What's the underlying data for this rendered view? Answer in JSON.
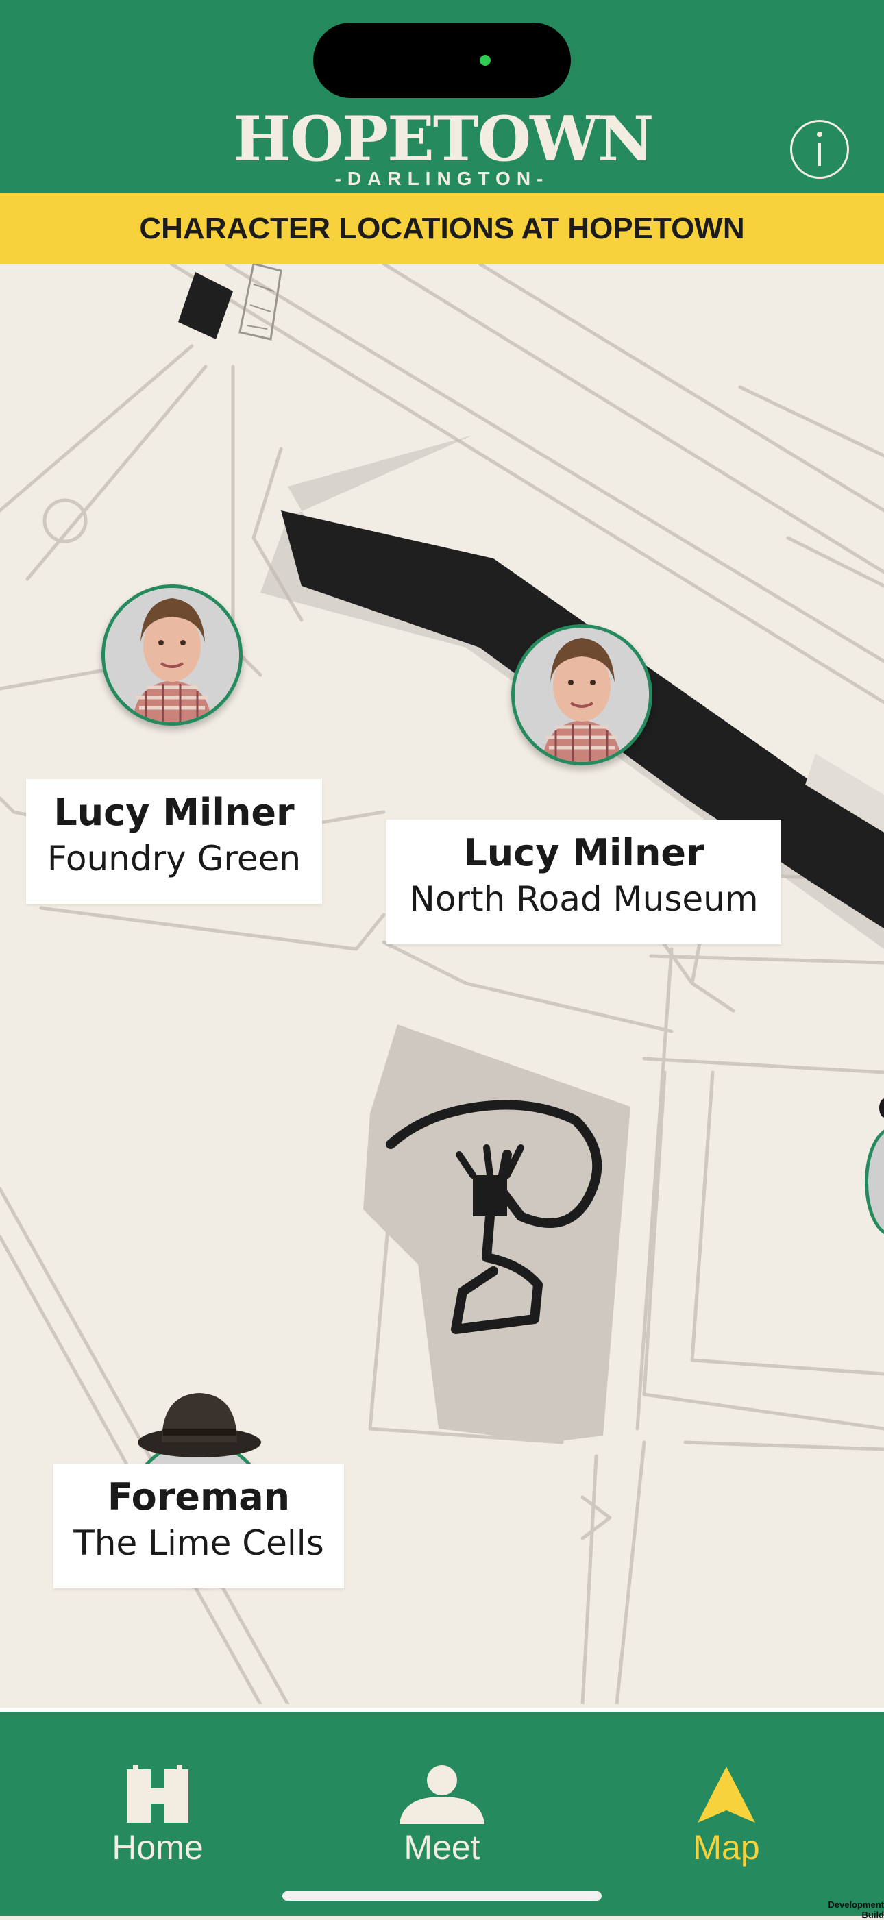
{
  "header": {
    "logo_title": "HOPETOWN",
    "logo_subtitle": "-DARLINGTON-",
    "info_icon": "info-icon"
  },
  "banner": {
    "title": "CHARACTER LOCATIONS AT HOPETOWN"
  },
  "map": {
    "characters": [
      {
        "name": "Lucy Milner",
        "location": "Foundry Green",
        "avatar": "lucy-milner-avatar"
      },
      {
        "name": "Lucy Milner",
        "location": "North Road Museum",
        "avatar": "lucy-milner-avatar"
      },
      {
        "name": "Foreman",
        "location": "The Lime Cells",
        "avatar": "foreman-avatar"
      }
    ]
  },
  "tabbar": {
    "items": [
      {
        "label": "Home",
        "icon": "hopetown-h-icon",
        "active": false
      },
      {
        "label": "Meet",
        "icon": "person-icon",
        "active": false
      },
      {
        "label": "Map",
        "icon": "navigation-arrow-icon",
        "active": true
      }
    ]
  },
  "footer": {
    "build_label": "Development Build"
  },
  "colors": {
    "brand_green": "#258a5e",
    "banner_yellow": "#f8d23c",
    "active_tab": "#f8d23c",
    "inactive_tab": "#f2ede0",
    "map_background": "#f1ece4"
  }
}
